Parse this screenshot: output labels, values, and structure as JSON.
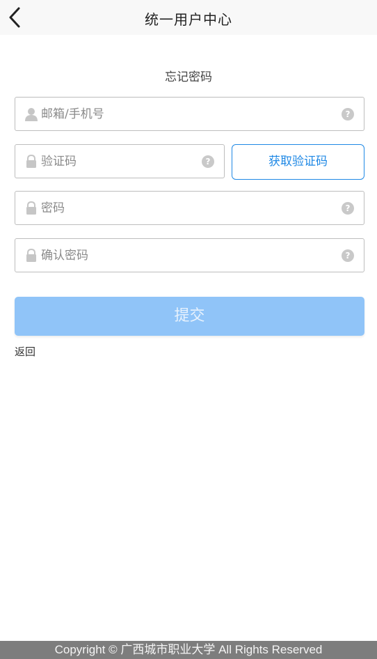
{
  "header": {
    "title": "统一用户中心",
    "back_icon": "chevron-left-icon"
  },
  "form": {
    "heading": "忘记密码",
    "email": {
      "placeholder": "邮箱/手机号",
      "icon": "user-icon",
      "help": "?"
    },
    "code": {
      "placeholder": "验证码",
      "icon": "lock-icon",
      "help": "?"
    },
    "get_code_label": "获取验证码",
    "password": {
      "placeholder": "密码",
      "icon": "lock-icon",
      "help": "?"
    },
    "confirm_password": {
      "placeholder": "确认密码",
      "icon": "lock-icon",
      "help": "?"
    },
    "submit_label": "提交",
    "return_label": "返回"
  },
  "footer": {
    "copyright": "Copyright © 广西城市职业大学 All Rights Reserved"
  },
  "colors": {
    "accent": "#1e88e5",
    "submit_disabled": "#90c4f8",
    "footer_bg": "#7d7d7d"
  }
}
